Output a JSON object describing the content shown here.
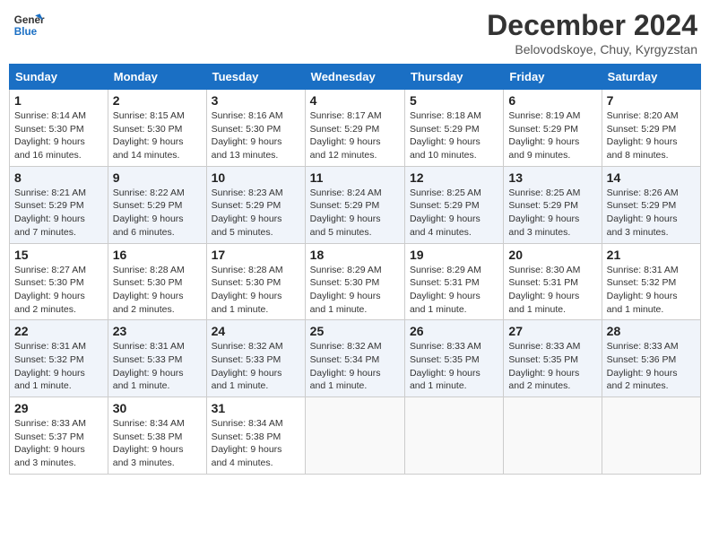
{
  "logo": {
    "line1": "General",
    "line2": "Blue"
  },
  "title": "December 2024",
  "subtitle": "Belovodskoye, Chuy, Kyrgyzstan",
  "days_of_week": [
    "Sunday",
    "Monday",
    "Tuesday",
    "Wednesday",
    "Thursday",
    "Friday",
    "Saturday"
  ],
  "weeks": [
    [
      {
        "day": "1",
        "info": "Sunrise: 8:14 AM\nSunset: 5:30 PM\nDaylight: 9 hours\nand 16 minutes."
      },
      {
        "day": "2",
        "info": "Sunrise: 8:15 AM\nSunset: 5:30 PM\nDaylight: 9 hours\nand 14 minutes."
      },
      {
        "day": "3",
        "info": "Sunrise: 8:16 AM\nSunset: 5:30 PM\nDaylight: 9 hours\nand 13 minutes."
      },
      {
        "day": "4",
        "info": "Sunrise: 8:17 AM\nSunset: 5:29 PM\nDaylight: 9 hours\nand 12 minutes."
      },
      {
        "day": "5",
        "info": "Sunrise: 8:18 AM\nSunset: 5:29 PM\nDaylight: 9 hours\nand 10 minutes."
      },
      {
        "day": "6",
        "info": "Sunrise: 8:19 AM\nSunset: 5:29 PM\nDaylight: 9 hours\nand 9 minutes."
      },
      {
        "day": "7",
        "info": "Sunrise: 8:20 AM\nSunset: 5:29 PM\nDaylight: 9 hours\nand 8 minutes."
      }
    ],
    [
      {
        "day": "8",
        "info": "Sunrise: 8:21 AM\nSunset: 5:29 PM\nDaylight: 9 hours\nand 7 minutes."
      },
      {
        "day": "9",
        "info": "Sunrise: 8:22 AM\nSunset: 5:29 PM\nDaylight: 9 hours\nand 6 minutes."
      },
      {
        "day": "10",
        "info": "Sunrise: 8:23 AM\nSunset: 5:29 PM\nDaylight: 9 hours\nand 5 minutes."
      },
      {
        "day": "11",
        "info": "Sunrise: 8:24 AM\nSunset: 5:29 PM\nDaylight: 9 hours\nand 5 minutes."
      },
      {
        "day": "12",
        "info": "Sunrise: 8:25 AM\nSunset: 5:29 PM\nDaylight: 9 hours\nand 4 minutes."
      },
      {
        "day": "13",
        "info": "Sunrise: 8:25 AM\nSunset: 5:29 PM\nDaylight: 9 hours\nand 3 minutes."
      },
      {
        "day": "14",
        "info": "Sunrise: 8:26 AM\nSunset: 5:29 PM\nDaylight: 9 hours\nand 3 minutes."
      }
    ],
    [
      {
        "day": "15",
        "info": "Sunrise: 8:27 AM\nSunset: 5:30 PM\nDaylight: 9 hours\nand 2 minutes."
      },
      {
        "day": "16",
        "info": "Sunrise: 8:28 AM\nSunset: 5:30 PM\nDaylight: 9 hours\nand 2 minutes."
      },
      {
        "day": "17",
        "info": "Sunrise: 8:28 AM\nSunset: 5:30 PM\nDaylight: 9 hours\nand 1 minute."
      },
      {
        "day": "18",
        "info": "Sunrise: 8:29 AM\nSunset: 5:30 PM\nDaylight: 9 hours\nand 1 minute."
      },
      {
        "day": "19",
        "info": "Sunrise: 8:29 AM\nSunset: 5:31 PM\nDaylight: 9 hours\nand 1 minute."
      },
      {
        "day": "20",
        "info": "Sunrise: 8:30 AM\nSunset: 5:31 PM\nDaylight: 9 hours\nand 1 minute."
      },
      {
        "day": "21",
        "info": "Sunrise: 8:31 AM\nSunset: 5:32 PM\nDaylight: 9 hours\nand 1 minute."
      }
    ],
    [
      {
        "day": "22",
        "info": "Sunrise: 8:31 AM\nSunset: 5:32 PM\nDaylight: 9 hours\nand 1 minute."
      },
      {
        "day": "23",
        "info": "Sunrise: 8:31 AM\nSunset: 5:33 PM\nDaylight: 9 hours\nand 1 minute."
      },
      {
        "day": "24",
        "info": "Sunrise: 8:32 AM\nSunset: 5:33 PM\nDaylight: 9 hours\nand 1 minute."
      },
      {
        "day": "25",
        "info": "Sunrise: 8:32 AM\nSunset: 5:34 PM\nDaylight: 9 hours\nand 1 minute."
      },
      {
        "day": "26",
        "info": "Sunrise: 8:33 AM\nSunset: 5:35 PM\nDaylight: 9 hours\nand 1 minute."
      },
      {
        "day": "27",
        "info": "Sunrise: 8:33 AM\nSunset: 5:35 PM\nDaylight: 9 hours\nand 2 minutes."
      },
      {
        "day": "28",
        "info": "Sunrise: 8:33 AM\nSunset: 5:36 PM\nDaylight: 9 hours\nand 2 minutes."
      }
    ],
    [
      {
        "day": "29",
        "info": "Sunrise: 8:33 AM\nSunset: 5:37 PM\nDaylight: 9 hours\nand 3 minutes."
      },
      {
        "day": "30",
        "info": "Sunrise: 8:34 AM\nSunset: 5:38 PM\nDaylight: 9 hours\nand 3 minutes."
      },
      {
        "day": "31",
        "info": "Sunrise: 8:34 AM\nSunset: 5:38 PM\nDaylight: 9 hours\nand 4 minutes."
      },
      {
        "day": "",
        "info": ""
      },
      {
        "day": "",
        "info": ""
      },
      {
        "day": "",
        "info": ""
      },
      {
        "day": "",
        "info": ""
      }
    ]
  ]
}
